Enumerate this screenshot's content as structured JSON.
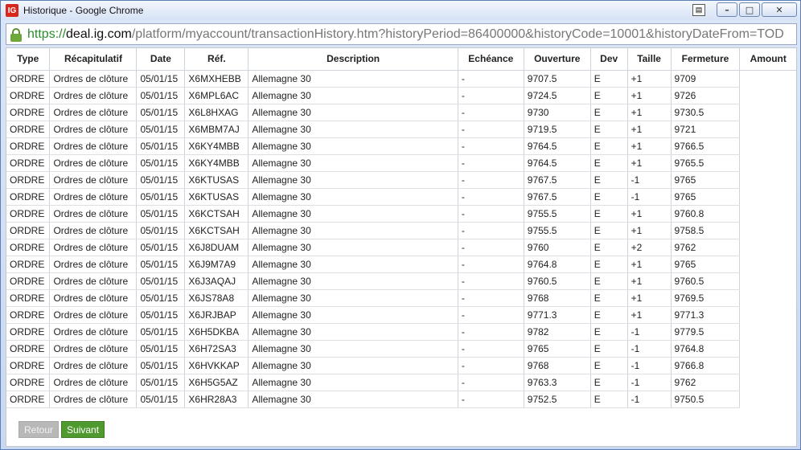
{
  "window": {
    "title": "Historique - Google Chrome",
    "app_icon_label": "IG",
    "extra_button_label": "▤",
    "minimize_label": "–",
    "maximize_label": "□",
    "close_label": "✕"
  },
  "url": {
    "scheme": "https://",
    "host": "deal.ig.com",
    "path": "/platform/myaccount/transactionHistory.htm?historyPeriod=86400000&historyCode=10001&historyDateFrom=TOD"
  },
  "table": {
    "headers": [
      "Type",
      "Récapitulatif",
      "Date",
      "Réf.",
      "Description",
      "Echéance",
      "Ouverture",
      "Dev",
      "Taille",
      "Fermeture",
      "Amount"
    ],
    "rows": [
      [
        "ORDRE",
        "Ordres de clôture",
        "05/01/15",
        "X6MXHEBB",
        "Allemagne 30",
        "-",
        "9707.5",
        "E",
        "+1",
        "9709"
      ],
      [
        "ORDRE",
        "Ordres de clôture",
        "05/01/15",
        "X6MPL6AC",
        "Allemagne 30",
        "-",
        "9724.5",
        "E",
        "+1",
        "9726"
      ],
      [
        "ORDRE",
        "Ordres de clôture",
        "05/01/15",
        "X6L8HXAG",
        "Allemagne 30",
        "-",
        "9730",
        "E",
        "+1",
        "9730.5"
      ],
      [
        "ORDRE",
        "Ordres de clôture",
        "05/01/15",
        "X6MBM7AJ",
        "Allemagne 30",
        "-",
        "9719.5",
        "E",
        "+1",
        "9721"
      ],
      [
        "ORDRE",
        "Ordres de clôture",
        "05/01/15",
        "X6KY4MBB",
        "Allemagne 30",
        "-",
        "9764.5",
        "E",
        "+1",
        "9766.5"
      ],
      [
        "ORDRE",
        "Ordres de clôture",
        "05/01/15",
        "X6KY4MBB",
        "Allemagne 30",
        "-",
        "9764.5",
        "E",
        "+1",
        "9765.5"
      ],
      [
        "ORDRE",
        "Ordres de clôture",
        "05/01/15",
        "X6KTUSAS",
        "Allemagne 30",
        "-",
        "9767.5",
        "E",
        "-1",
        "9765"
      ],
      [
        "ORDRE",
        "Ordres de clôture",
        "05/01/15",
        "X6KTUSAS",
        "Allemagne 30",
        "-",
        "9767.5",
        "E",
        "-1",
        "9765"
      ],
      [
        "ORDRE",
        "Ordres de clôture",
        "05/01/15",
        "X6KCTSAH",
        "Allemagne 30",
        "-",
        "9755.5",
        "E",
        "+1",
        "9760.8"
      ],
      [
        "ORDRE",
        "Ordres de clôture",
        "05/01/15",
        "X6KCTSAH",
        "Allemagne 30",
        "-",
        "9755.5",
        "E",
        "+1",
        "9758.5"
      ],
      [
        "ORDRE",
        "Ordres de clôture",
        "05/01/15",
        "X6J8DUAM",
        "Allemagne 30",
        "-",
        "9760",
        "E",
        "+2",
        "9762"
      ],
      [
        "ORDRE",
        "Ordres de clôture",
        "05/01/15",
        "X6J9M7A9",
        "Allemagne 30",
        "-",
        "9764.8",
        "E",
        "+1",
        "9765"
      ],
      [
        "ORDRE",
        "Ordres de clôture",
        "05/01/15",
        "X6J3AQAJ",
        "Allemagne 30",
        "-",
        "9760.5",
        "E",
        "+1",
        "9760.5"
      ],
      [
        "ORDRE",
        "Ordres de clôture",
        "05/01/15",
        "X6JS78A8",
        "Allemagne 30",
        "-",
        "9768",
        "E",
        "+1",
        "9769.5"
      ],
      [
        "ORDRE",
        "Ordres de clôture",
        "05/01/15",
        "X6JRJBAP",
        "Allemagne 30",
        "-",
        "9771.3",
        "E",
        "+1",
        "9771.3"
      ],
      [
        "ORDRE",
        "Ordres de clôture",
        "05/01/15",
        "X6H5DKBA",
        "Allemagne 30",
        "-",
        "9782",
        "E",
        "-1",
        "9779.5"
      ],
      [
        "ORDRE",
        "Ordres de clôture",
        "05/01/15",
        "X6H72SA3",
        "Allemagne 30",
        "-",
        "9765",
        "E",
        "-1",
        "9764.8"
      ],
      [
        "ORDRE",
        "Ordres de clôture",
        "05/01/15",
        "X6HVKKAP",
        "Allemagne 30",
        "-",
        "9768",
        "E",
        "-1",
        "9766.8"
      ],
      [
        "ORDRE",
        "Ordres de clôture",
        "05/01/15",
        "X6H5G5AZ",
        "Allemagne 30",
        "-",
        "9763.3",
        "E",
        "-1",
        "9762"
      ],
      [
        "ORDRE",
        "Ordres de clôture",
        "05/01/15",
        "X6HR28A3",
        "Allemagne 30",
        "-",
        "9752.5",
        "E",
        "-1",
        "9750.5"
      ]
    ]
  },
  "pager": {
    "prev_label": "Retour",
    "next_label": "Suivant"
  }
}
